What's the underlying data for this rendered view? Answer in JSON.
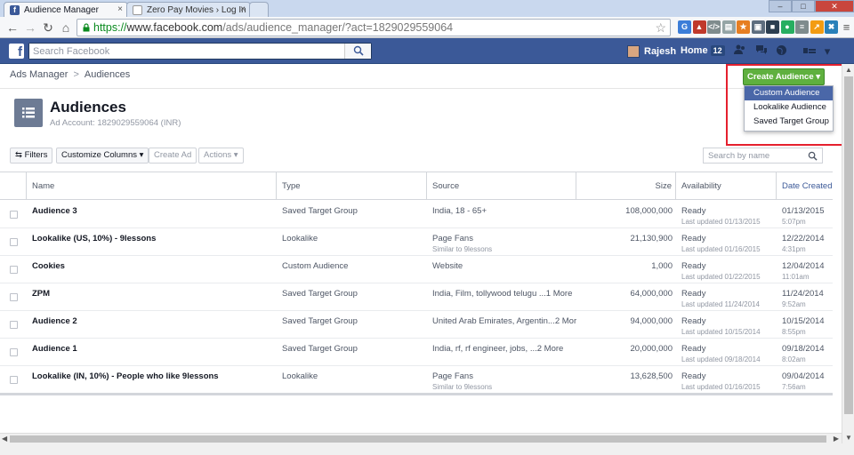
{
  "browser": {
    "tabs": [
      {
        "label": "Audience Manager",
        "active": true
      },
      {
        "label": "Zero Pay Movies › Log In",
        "active": false
      }
    ],
    "url_scheme": "https://",
    "url_host": "www.facebook.com",
    "url_path": "/ads/audience_manager/?act=1829029559064",
    "window_buttons": [
      "–",
      "□",
      "✕"
    ],
    "extensions": [
      {
        "name": "ext-globe-icon",
        "color": "#3b7dd8",
        "glyph": "G"
      },
      {
        "name": "ext-car-icon",
        "color": "#c0392b",
        "glyph": "▲"
      },
      {
        "name": "ext-code-icon",
        "color": "#7f8c8d",
        "glyph": "</>"
      },
      {
        "name": "ext-page-icon",
        "color": "#95a5a6",
        "glyph": "▤"
      },
      {
        "name": "ext-star-icon",
        "color": "#e67e22",
        "glyph": "★"
      },
      {
        "name": "ext-window-icon",
        "color": "#5d6d7e",
        "glyph": "▣"
      },
      {
        "name": "ext-lock-icon",
        "color": "#2c3e50",
        "glyph": "■"
      },
      {
        "name": "ext-pin-icon",
        "color": "#27ae60",
        "glyph": "●"
      },
      {
        "name": "ext-list-icon",
        "color": "#7f8c8d",
        "glyph": "≡"
      },
      {
        "name": "ext-chart-icon",
        "color": "#f39c12",
        "glyph": "↗"
      },
      {
        "name": "ext-x-icon",
        "color": "#2980b9",
        "glyph": "✖"
      }
    ]
  },
  "fb": {
    "logo": "f",
    "search_placeholder": "Search Facebook",
    "user_name": "Rajesh",
    "home_label": "Home",
    "home_count": "12"
  },
  "breadcrumb": {
    "root": "Ads Manager",
    "separator": ">",
    "current": "Audiences"
  },
  "header": {
    "title": "Audiences",
    "account": "Ad Account: 1829029559064 (INR)"
  },
  "create_menu": {
    "button_label": "Create Audience ▾",
    "items": [
      "Custom Audience",
      "Lookalike Audience",
      "Saved Target Group"
    ]
  },
  "toolbar": {
    "filters": "⇆ Filters",
    "customize": "Customize Columns ▾",
    "create_ad": "Create Ad",
    "actions": "Actions ▾",
    "search_placeholder": "Search by name"
  },
  "table": {
    "columns": [
      "Name",
      "Type",
      "Source",
      "Size",
      "Availability",
      "Date Created"
    ],
    "rows": [
      {
        "name": "Audience 3",
        "type": "Saved Target Group",
        "source": "India, 18 - 65+",
        "source_sub": "",
        "size": "108,000,000",
        "avail": "Ready",
        "avail_sub": "Last updated 01/13/2015",
        "date": "01/13/2015",
        "time": "5:07pm"
      },
      {
        "name": "Lookalike (US, 10%) - 9lessons",
        "type": "Lookalike",
        "source": "Page Fans",
        "source_sub": "Similar to 9lessons",
        "size": "21,130,900",
        "avail": "Ready",
        "avail_sub": "Last updated 01/16/2015",
        "date": "12/22/2014",
        "time": "4:31pm"
      },
      {
        "name": "Cookies",
        "type": "Custom Audience",
        "source": "Website",
        "source_sub": "",
        "size": "1,000",
        "avail": "Ready",
        "avail_sub": "Last updated 01/22/2015",
        "date": "12/04/2014",
        "time": "11:01am"
      },
      {
        "name": "ZPM",
        "type": "Saved Target Group",
        "source": "India, Film, tollywood telugu ...1 More",
        "source_sub": "",
        "size": "64,000,000",
        "avail": "Ready",
        "avail_sub": "Last updated 11/24/2014",
        "date": "11/24/2014",
        "time": "9:52am"
      },
      {
        "name": "Audience 2",
        "type": "Saved Target Group",
        "source": "United Arab Emirates, Argentin...2 More",
        "source_sub": "",
        "size": "94,000,000",
        "avail": "Ready",
        "avail_sub": "Last updated 10/15/2014",
        "date": "10/15/2014",
        "time": "8:55pm"
      },
      {
        "name": "Audience 1",
        "type": "Saved Target Group",
        "source": "India, rf, rf engineer, jobs, ...2 More",
        "source_sub": "",
        "size": "20,000,000",
        "avail": "Ready",
        "avail_sub": "Last updated 09/18/2014",
        "date": "09/18/2014",
        "time": "8:02am"
      },
      {
        "name": "Lookalike (IN, 10%) - People who like 9lessons",
        "type": "Lookalike",
        "source": "Page Fans",
        "source_sub": "Similar to 9lessons",
        "size": "13,628,500",
        "avail": "Ready",
        "avail_sub": "Last updated 01/16/2015",
        "date": "09/04/2014",
        "time": "7:56am"
      }
    ]
  }
}
